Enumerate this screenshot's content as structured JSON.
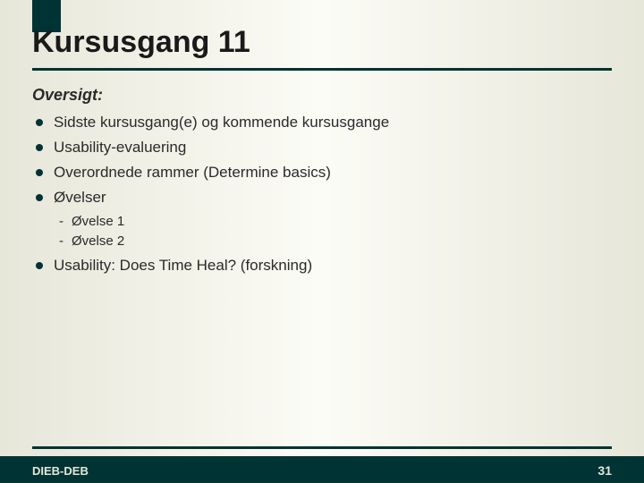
{
  "title": "Kursusgang 11",
  "heading": "Oversigt:",
  "bullets": {
    "b0": "Sidste kursusgang(e) og kommende kursusgange",
    "b1": "Usability-evaluering",
    "b2": "Overordnede rammer (Determine basics)",
    "b3": "Øvelser",
    "b4": "Usability: Does Time Heal? (forskning)"
  },
  "sub": {
    "s0": "Øvelse 1",
    "s1": "Øvelse 2"
  },
  "footer": {
    "left": "DIEB-DEB",
    "page": "31"
  }
}
